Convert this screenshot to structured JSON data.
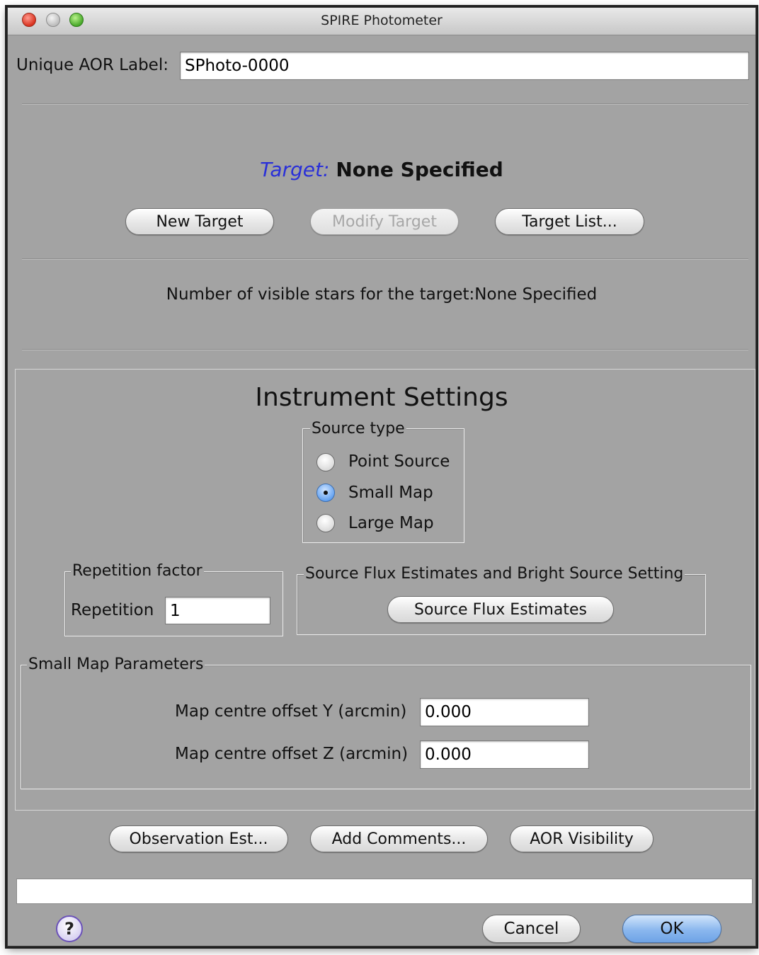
{
  "window": {
    "title": "SPIRE Photometer"
  },
  "aor": {
    "label": "Unique AOR Label:",
    "value": "SPhoto-0000"
  },
  "target": {
    "key": "Target:",
    "value": "None Specified",
    "buttons": {
      "new": "New Target",
      "modify": "Modify Target",
      "list": "Target List..."
    },
    "visible_stars_text": "Number of visible stars for the target:None Specified"
  },
  "instrument": {
    "title": "Instrument Settings",
    "source_type": {
      "legend": "Source type",
      "options": [
        "Point Source",
        "Small Map",
        "Large Map"
      ],
      "selected": "Small Map"
    },
    "repetition": {
      "legend": "Repetition factor",
      "label": "Repetition",
      "value": "1"
    },
    "flux": {
      "legend": "Source Flux Estimates and Bright Source Setting",
      "button": "Source Flux Estimates"
    },
    "small_map": {
      "legend": "Small Map Parameters",
      "offset_y_label": "Map centre offset Y (arcmin)",
      "offset_y_value": "0.000",
      "offset_z_label": "Map centre offset Z (arcmin)",
      "offset_z_value": "0.000"
    }
  },
  "actions": {
    "observation_est": "Observation Est...",
    "add_comments": "Add Comments...",
    "aor_visibility": "AOR Visibility"
  },
  "footer": {
    "help": "?",
    "cancel": "Cancel",
    "ok": "OK",
    "status": ""
  },
  "colors": {
    "window_bg": "#a3a3a3",
    "target_key": "#2a30d8",
    "default_button": "#8ab7ee"
  }
}
